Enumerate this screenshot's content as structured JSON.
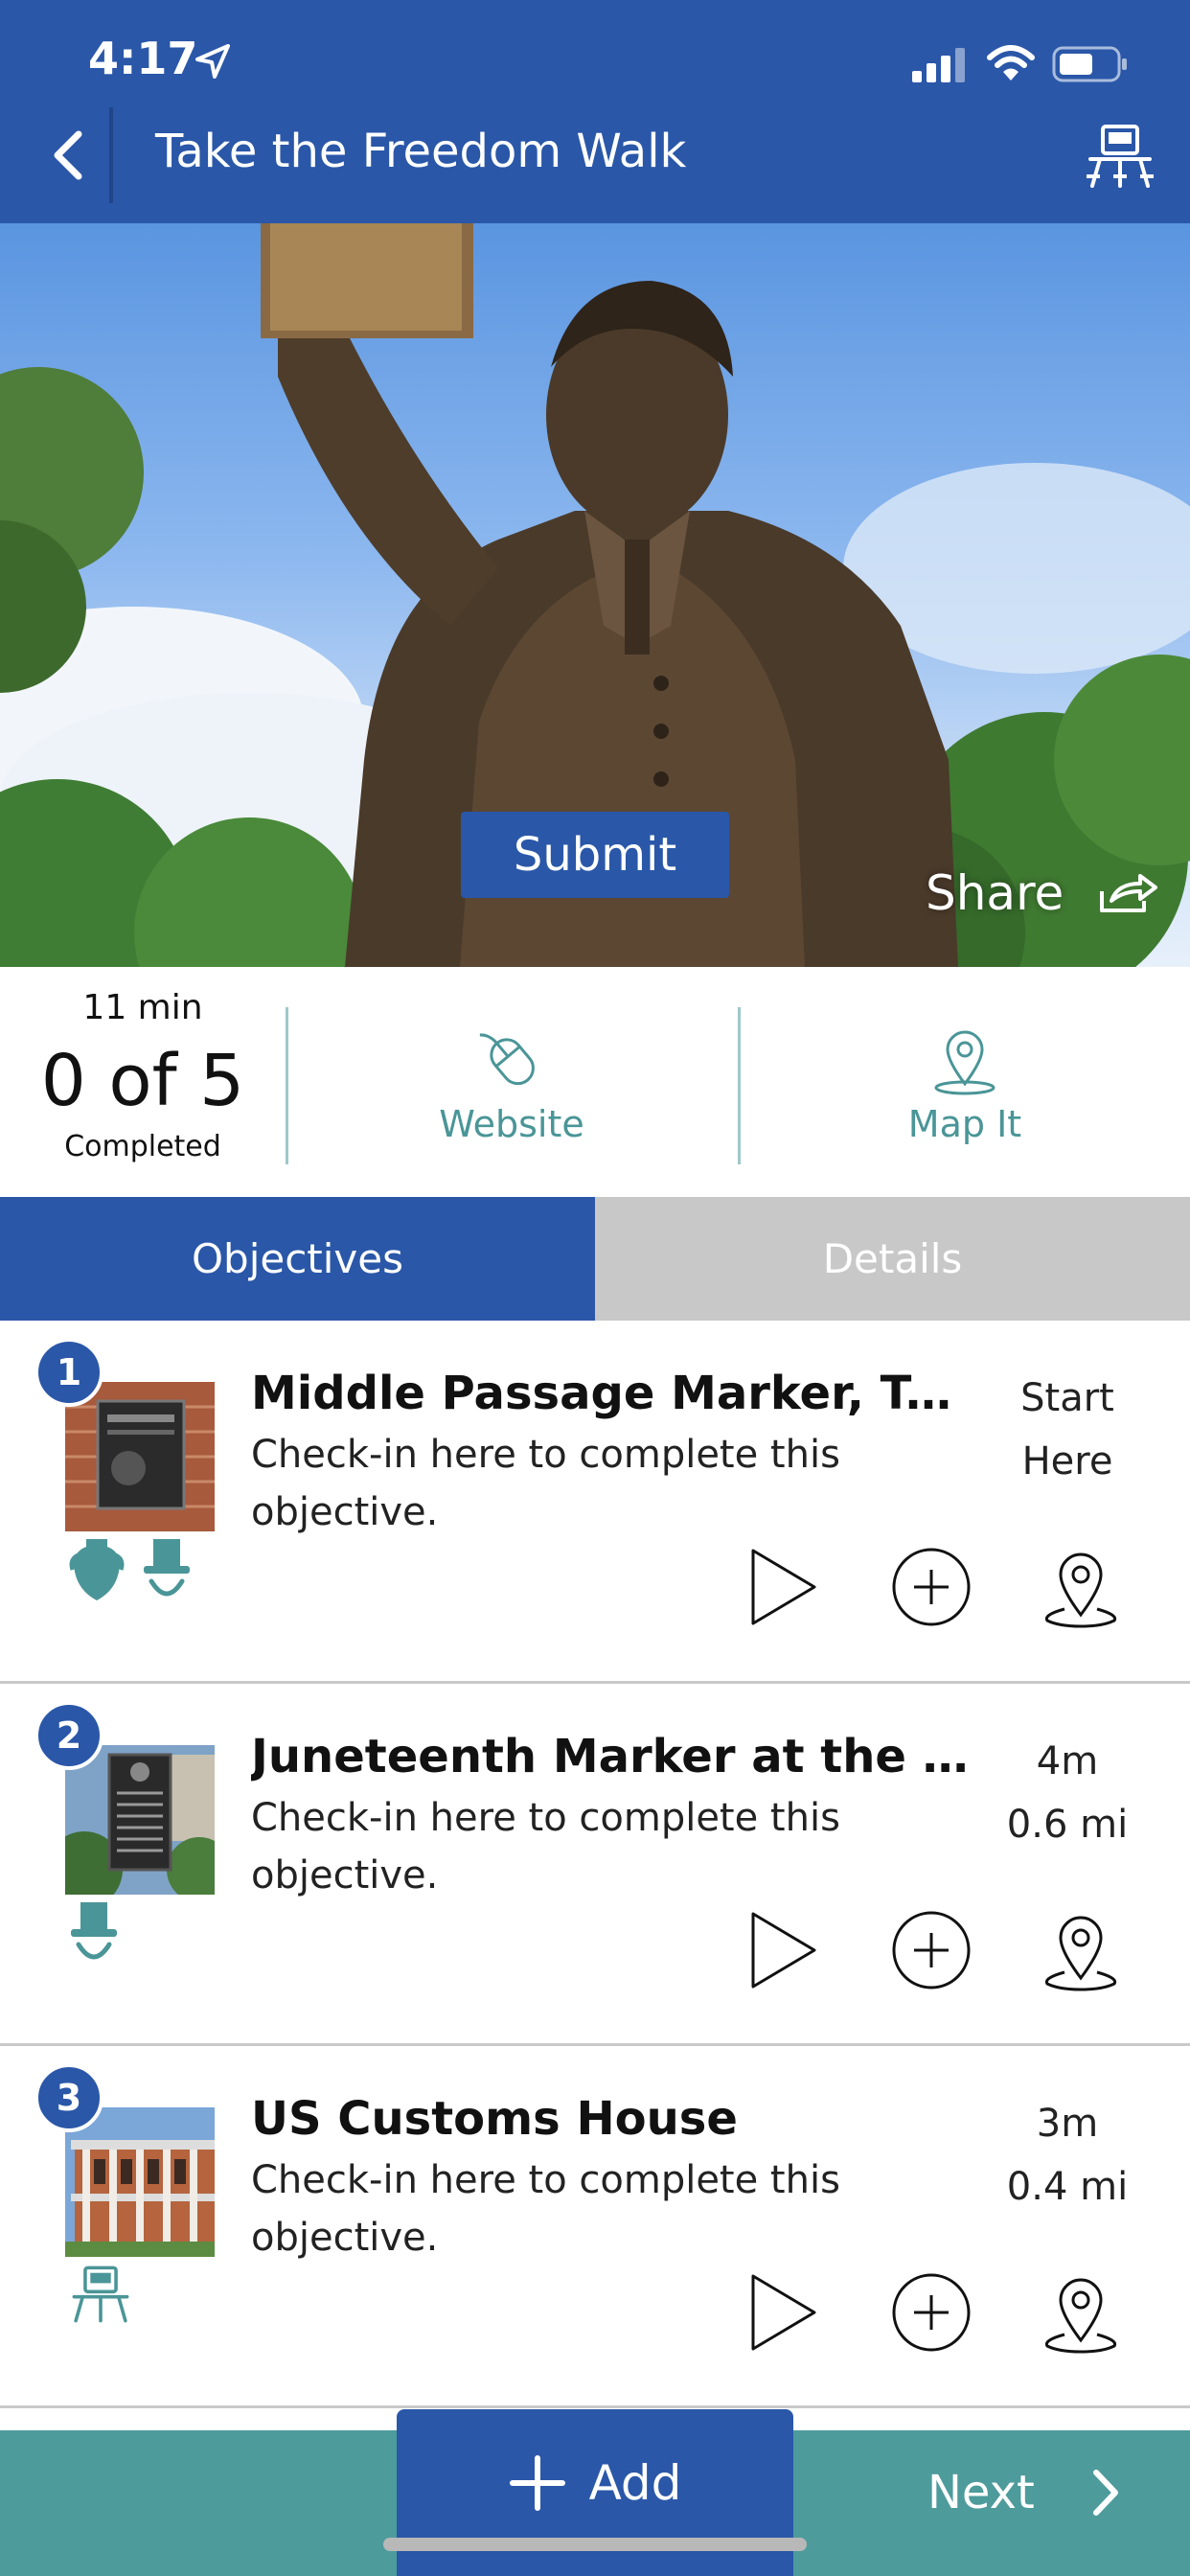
{
  "status_bar": {
    "time": "4:17"
  },
  "header": {
    "title": "Take the Freedom Walk",
    "back_icon": "chevron-left-icon",
    "right_icon": "easel-icon"
  },
  "hero": {
    "submit_label": "Submit",
    "share_label": "Share"
  },
  "stats": {
    "duration": "11 min",
    "progress": "0 of 5",
    "completed_label": "Completed",
    "website_label": "Website",
    "map_label": "Map It"
  },
  "tabs": [
    {
      "label": "Objectives",
      "active": true
    },
    {
      "label": "Details",
      "active": false
    }
  ],
  "objectives": [
    {
      "number": "1",
      "title": "Middle Passage Marker, Texas...",
      "description": "Check-in here to complete this objective.",
      "meta_line1": "Start",
      "meta_line2": "Here",
      "badges": [
        "vase-icon",
        "top-hat-icon"
      ]
    },
    {
      "number": "2",
      "title": "Juneteenth Marker at the site...",
      "description": "Check-in here to complete this objective.",
      "meta_line1": "4m",
      "meta_line2": "0.6 mi",
      "badges": [
        "top-hat-icon"
      ]
    },
    {
      "number": "3",
      "title": "US Customs House",
      "description": "Check-in here to complete this objective.",
      "meta_line1": "3m",
      "meta_line2": "0.4 mi",
      "badges": [
        "easel-icon"
      ]
    }
  ],
  "bottom_bar": {
    "add_label": "Add",
    "next_label": "Next"
  },
  "colors": {
    "primary_blue": "#2a57a8",
    "teal": "#4e9b9c",
    "tab_inactive": "#c8c8c8"
  }
}
